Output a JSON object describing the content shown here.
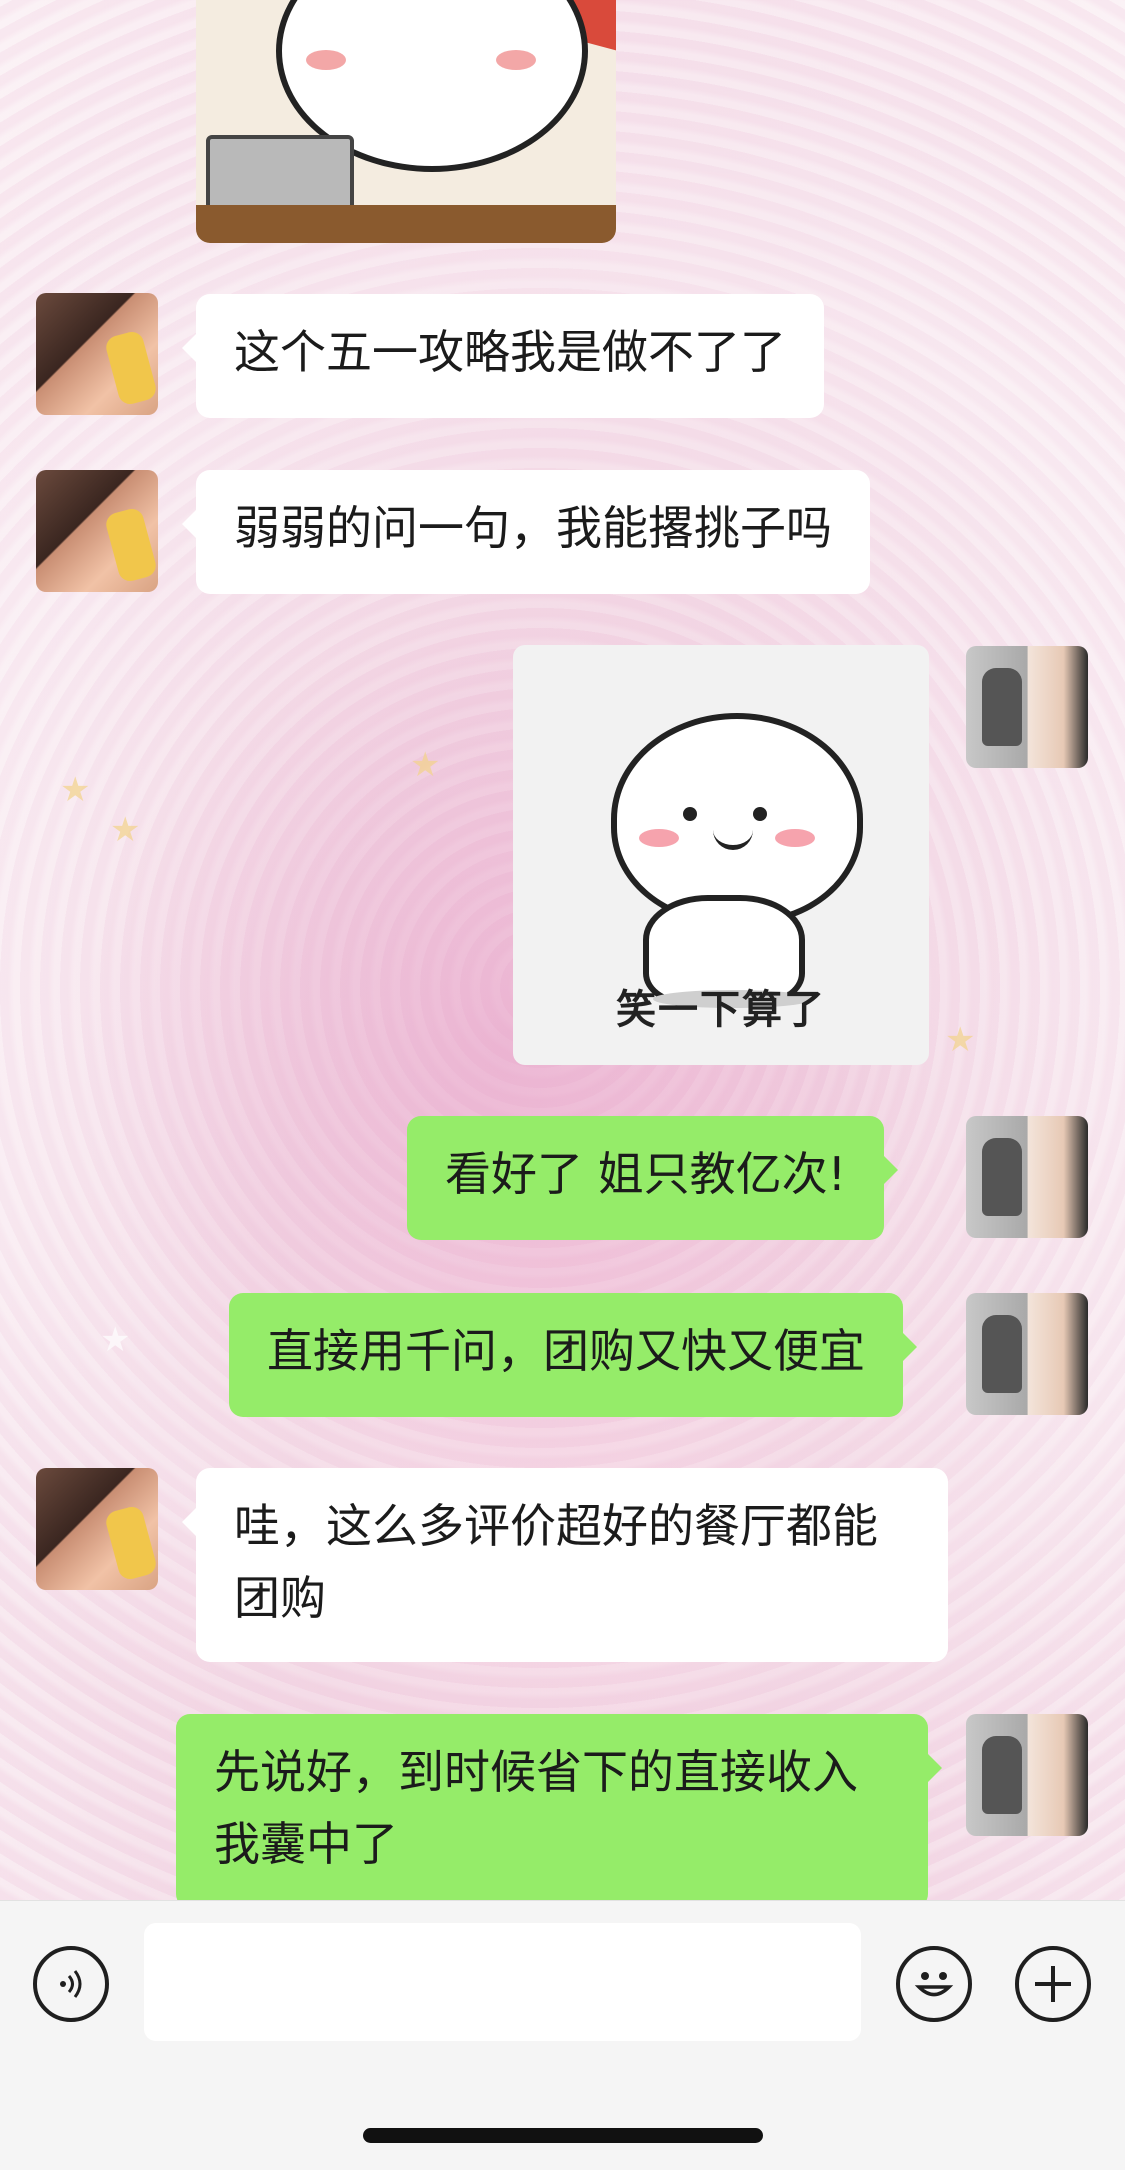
{
  "chat": {
    "messages": [
      {
        "side": "left",
        "type": "text",
        "text": "这个五一攻略我是做不了了"
      },
      {
        "side": "left",
        "type": "text",
        "text": "弱弱的问一句，我能撂挑子吗"
      },
      {
        "side": "right",
        "type": "sticker",
        "caption": "笑一下算了"
      },
      {
        "side": "right",
        "type": "text",
        "text": "看好了 姐只教亿次!"
      },
      {
        "side": "right",
        "type": "text",
        "text": "直接用千问，团购又快又便宜"
      },
      {
        "side": "left",
        "type": "text",
        "line1": "哇，这么多评价超好的餐厅都能",
        "line2": "团购"
      },
      {
        "side": "right",
        "type": "text",
        "line1": "先说好，到时候省下的直接收入",
        "line2": "我囊中了"
      }
    ]
  },
  "input_bar": {
    "voice_icon": "voice-icon",
    "emoji_icon": "emoji-icon",
    "add_icon": "plus-icon",
    "input_value": ""
  },
  "colors": {
    "sent_bubble": "#95ec69",
    "received_bubble": "#ffffff",
    "input_bar_bg": "#f5f5f5"
  }
}
